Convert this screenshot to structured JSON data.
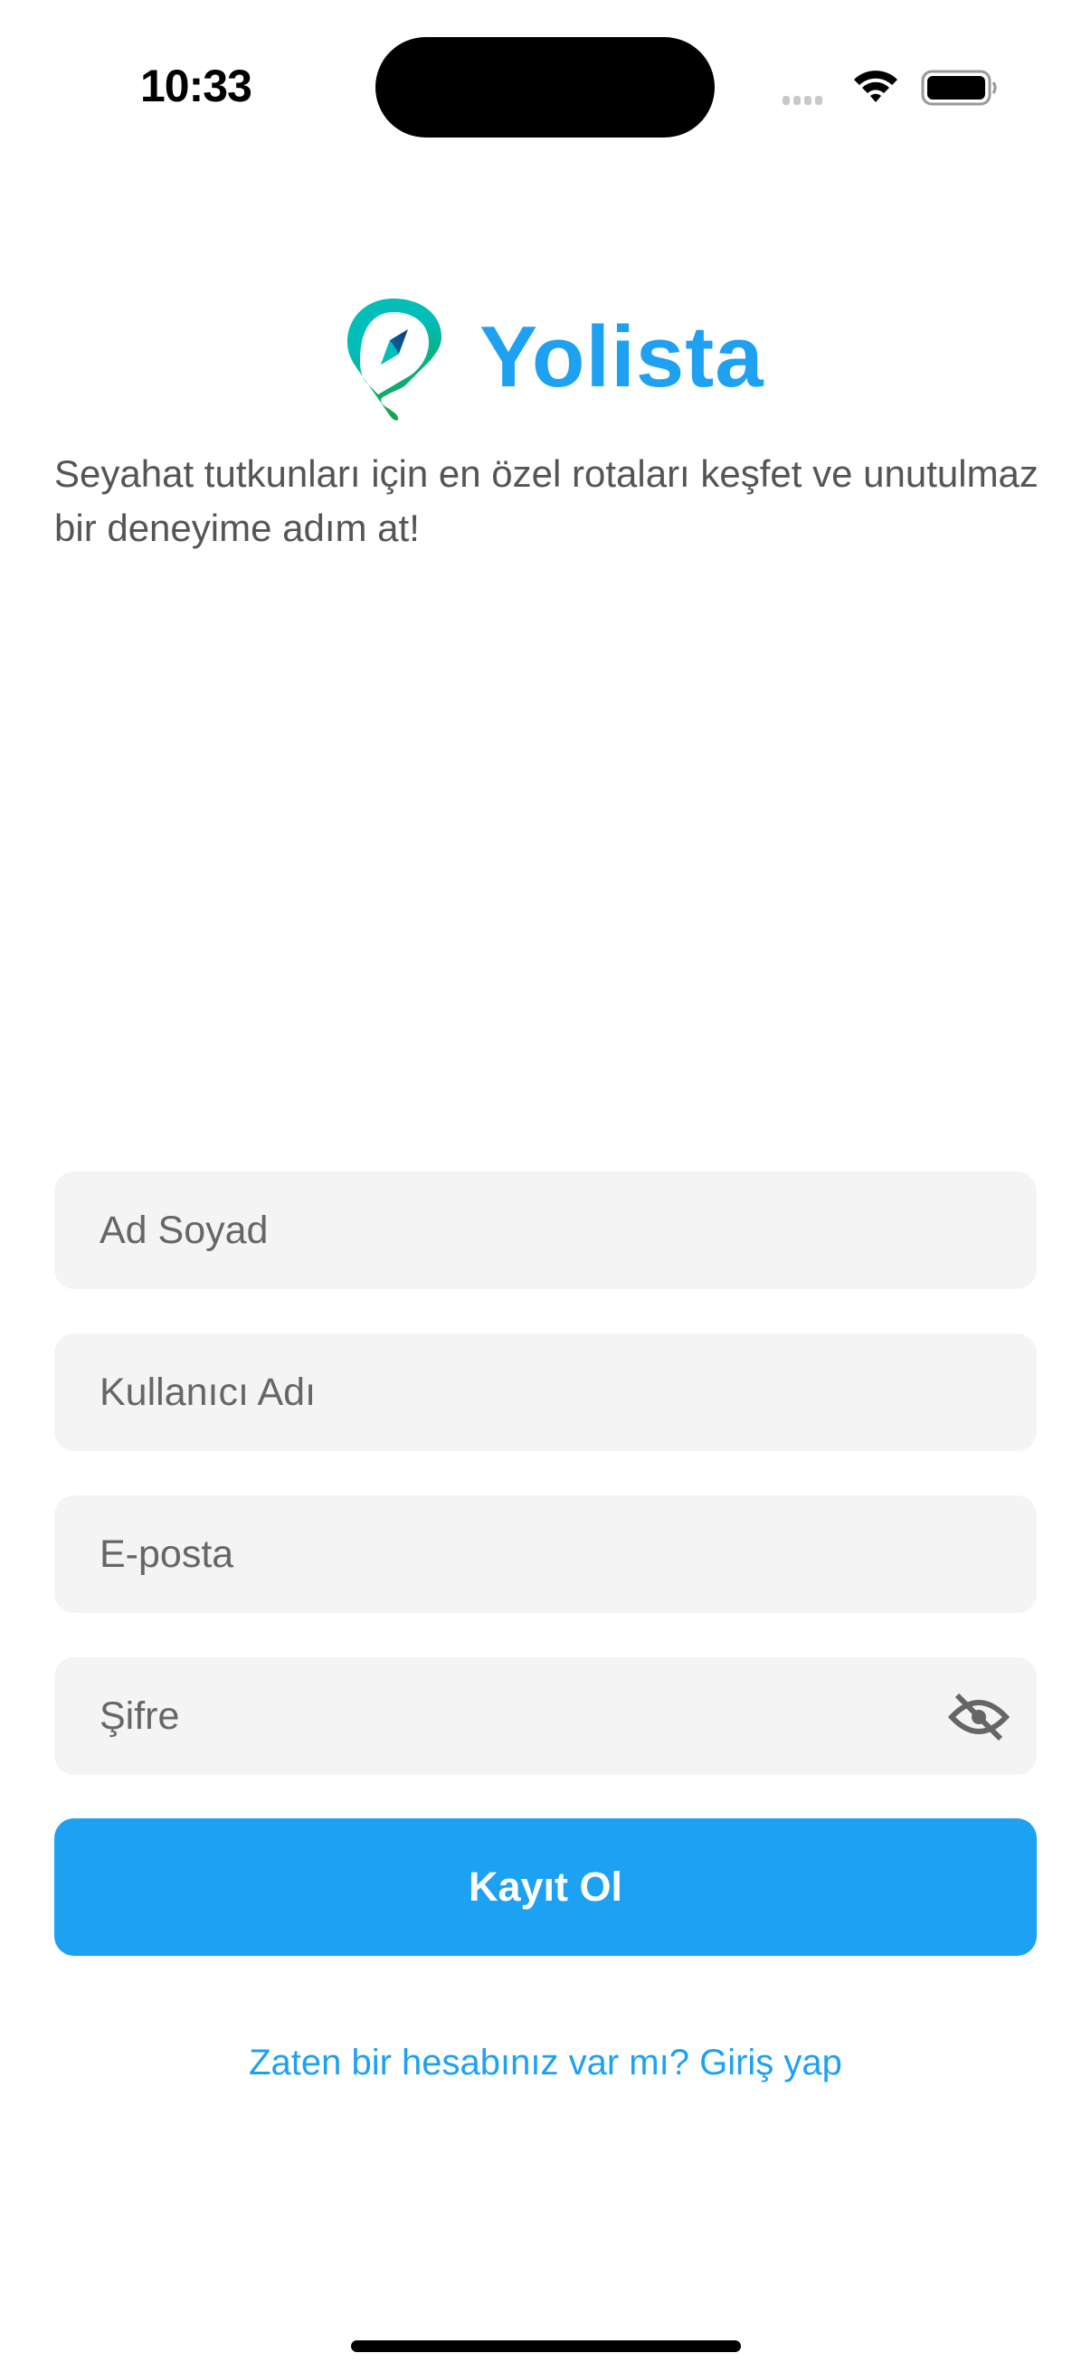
{
  "status_bar": {
    "time": "10:33",
    "icons": [
      "signal-icon",
      "wifi-icon",
      "battery-icon"
    ]
  },
  "brand": {
    "name": "Yolista",
    "logo": "map-pin-compass-logo",
    "color": "#1fa1f2"
  },
  "subtitle": "Seyahat tutkunları için en özel rotaları keşfet ve unutulmaz bir deneyime adım at!",
  "form": {
    "full_name_placeholder": "Ad Soyad",
    "username_placeholder": "Kullanıcı Adı",
    "email_placeholder": "E-posta",
    "password_placeholder": "Şifre",
    "password_toggle_icon": "eye-off-icon",
    "submit_label": "Kayıt Ol",
    "accent_color": "#1da1f2"
  },
  "login_link": "Zaten bir hesabınız var mı? Giriş yap"
}
